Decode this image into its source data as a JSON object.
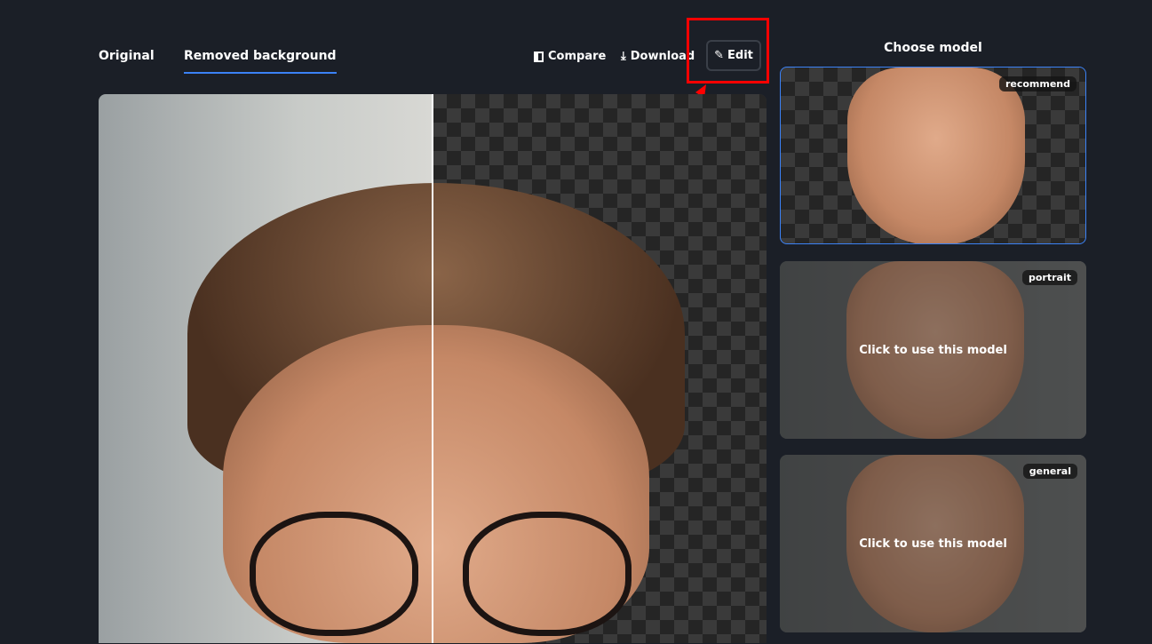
{
  "tabs": [
    {
      "label": "Original"
    },
    {
      "label": "Removed background"
    }
  ],
  "toolbar": {
    "compare": "Compare",
    "download": "Download",
    "edit": "Edit"
  },
  "sidebar": {
    "title": "Choose model",
    "models": [
      {
        "badge": "recommend",
        "selected": true
      },
      {
        "badge": "portrait",
        "overlay": "Click to use this model"
      },
      {
        "badge": "general",
        "overlay": "Click to use this model"
      }
    ]
  },
  "colors": {
    "accent": "#3b82f6",
    "highlight": "#ff0000",
    "background": "#1b1f27"
  }
}
